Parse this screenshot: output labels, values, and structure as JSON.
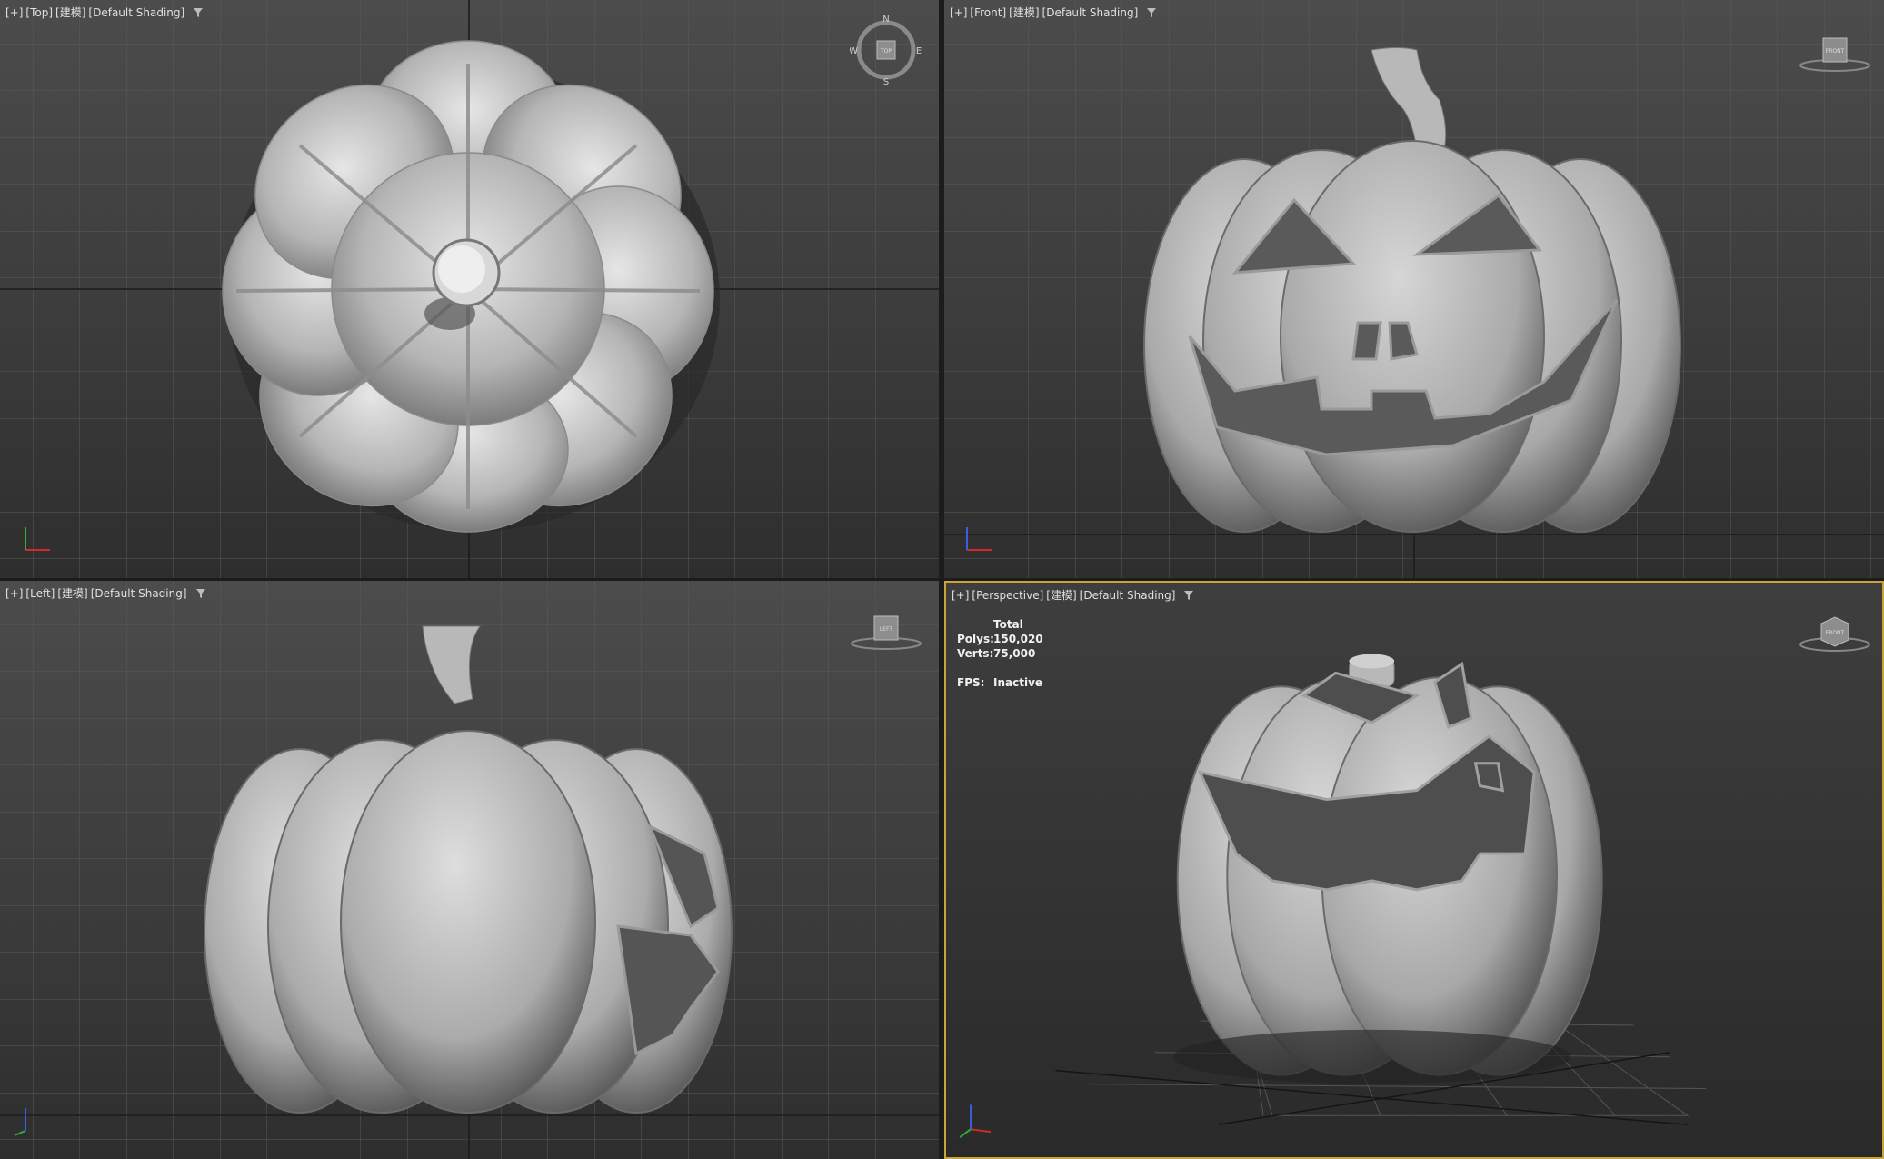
{
  "viewports": {
    "top": {
      "plus": "[+]",
      "view": "[Top]",
      "mode": "[建模]",
      "shading": "[Default Shading]",
      "compass": {
        "n": "N",
        "s": "S",
        "e": "E",
        "w": "W",
        "cube": "TOP"
      }
    },
    "front": {
      "plus": "[+]",
      "view": "[Front]",
      "mode": "[建模]",
      "shading": "[Default Shading]",
      "cube": "FRONT"
    },
    "left": {
      "plus": "[+]",
      "view": "[Left]",
      "mode": "[建模]",
      "shading": "[Default Shading]",
      "cube": "LEFT"
    },
    "perspective": {
      "plus": "[+]",
      "view": "[Perspective]",
      "mode": "[建模]",
      "shading": "[Default Shading]",
      "cube": "FRONT",
      "stats": {
        "header": "Total",
        "polys_label": "Polys:",
        "polys_value": "150,020",
        "verts_label": "Verts:",
        "verts_value": "75,000",
        "fps_label": "FPS:",
        "fps_value": "Inactive"
      }
    }
  },
  "colors": {
    "active_border": "#c9a43a",
    "axis_x": "#d02a2a",
    "axis_y": "#2fae3a",
    "axis_z": "#3a5fe0"
  }
}
